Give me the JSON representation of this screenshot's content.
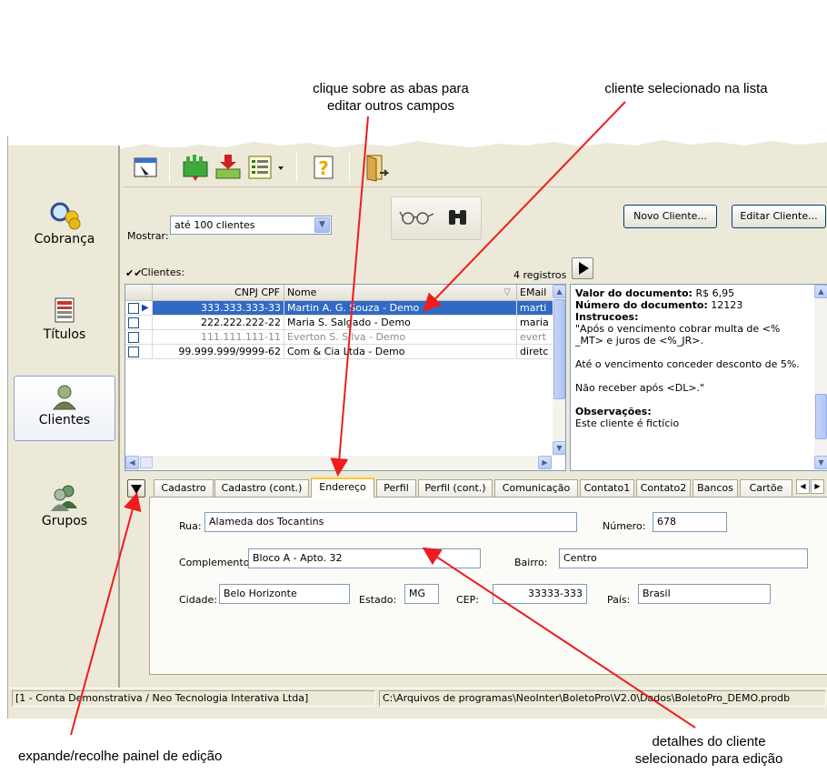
{
  "annotations": {
    "tabs_hint_line1": "clique sobre as abas para",
    "tabs_hint_line2": "editar outros campos",
    "selected_hint": "cliente selecionado na lista",
    "expand_hint": "expande/recolhe painel de edição",
    "details_hint_line1": "detalhes do cliente",
    "details_hint_line2": "selecionado para edição"
  },
  "sidebar": {
    "items": [
      {
        "label": "Cobrança",
        "icon": "billing-magnifier-icon"
      },
      {
        "label": "Títulos",
        "icon": "documents-icon"
      },
      {
        "label": "Clientes",
        "icon": "client-icon",
        "active": true
      },
      {
        "label": "Grupos",
        "icon": "group-icon"
      }
    ]
  },
  "toolbar": {
    "buttons": [
      "search-window-icon",
      "bank-green-icon",
      "import-icon",
      "list-icon",
      "help-icon",
      "exit-door-icon"
    ]
  },
  "filter": {
    "label": "Mostrar:",
    "value": "até 100 clientes"
  },
  "buttons": {
    "new_client": "Novo Cliente...",
    "edit_client": "Editar Cliente..."
  },
  "list": {
    "title": "Clientes:",
    "count": "4 registros",
    "columns": [
      "CNPJ CPF",
      "Nome",
      "EMail"
    ],
    "rows": [
      {
        "cnpj": "333.333.333-33",
        "nome": "Martin A. G. Souza - Demo",
        "email": "marti",
        "selected": true
      },
      {
        "cnpj": "222.222.222-22",
        "nome": "Maria S. Salgado - Demo",
        "email": "maria"
      },
      {
        "cnpj": "111.111.111-11",
        "nome": "Everton S. Silva - Demo",
        "email": "evert",
        "dim": true
      },
      {
        "cnpj": "99.999.999/9999-62",
        "nome": "Com & Cia Ltda - Demo",
        "email": "diretc"
      }
    ]
  },
  "memo": {
    "valor_label": "Valor do documento:",
    "valor": "R$ 6,95",
    "numero_label": "Número do documento:",
    "numero": "12123",
    "instr_label": "Instrucoes:",
    "instr_1": "\"Após o vencimento cobrar multa de <%",
    "instr_2": "_MT> e juros de <%_JR>.",
    "instr_3": "Até o vencimento conceder desconto de 5%.",
    "instr_4": "Não receber após <DL>.\"",
    "obs_label": "Observações:",
    "obs": "Este cliente é fictício"
  },
  "tabs": [
    "Cadastro",
    "Cadastro (cont.)",
    "Endereço",
    "Perfil",
    "Perfil (cont.)",
    "Comunicação",
    "Contato1",
    "Contato2",
    "Bancos",
    "Cartõe"
  ],
  "form": {
    "rua_label": "Rua:",
    "rua": "Alameda dos Tocantins",
    "numero_label": "Número:",
    "numero": "678",
    "complemento_label": "Complemento:",
    "complemento": "Bloco A - Apto. 32",
    "bairro_label": "Bairro:",
    "bairro": "Centro",
    "cidade_label": "Cidade:",
    "cidade": "Belo Horizonte",
    "estado_label": "Estado:",
    "estado": "MG",
    "cep_label": "CEP:",
    "cep": "33333-333",
    "pais_label": "País:",
    "pais": "Brasil"
  },
  "status": {
    "left": "[1 - Conta Demonstrativa / Neo Tecnologia Interativa Ltda]",
    "right": "C:\\Arquivos de programas\\NeoInter\\BoletoPro\\V2.0\\Dados\\BoletoPro_DEMO.prodb"
  },
  "colors": {
    "selection": "#316ac5",
    "arrow": "#ee1c1c",
    "window": "#ece9d8"
  }
}
